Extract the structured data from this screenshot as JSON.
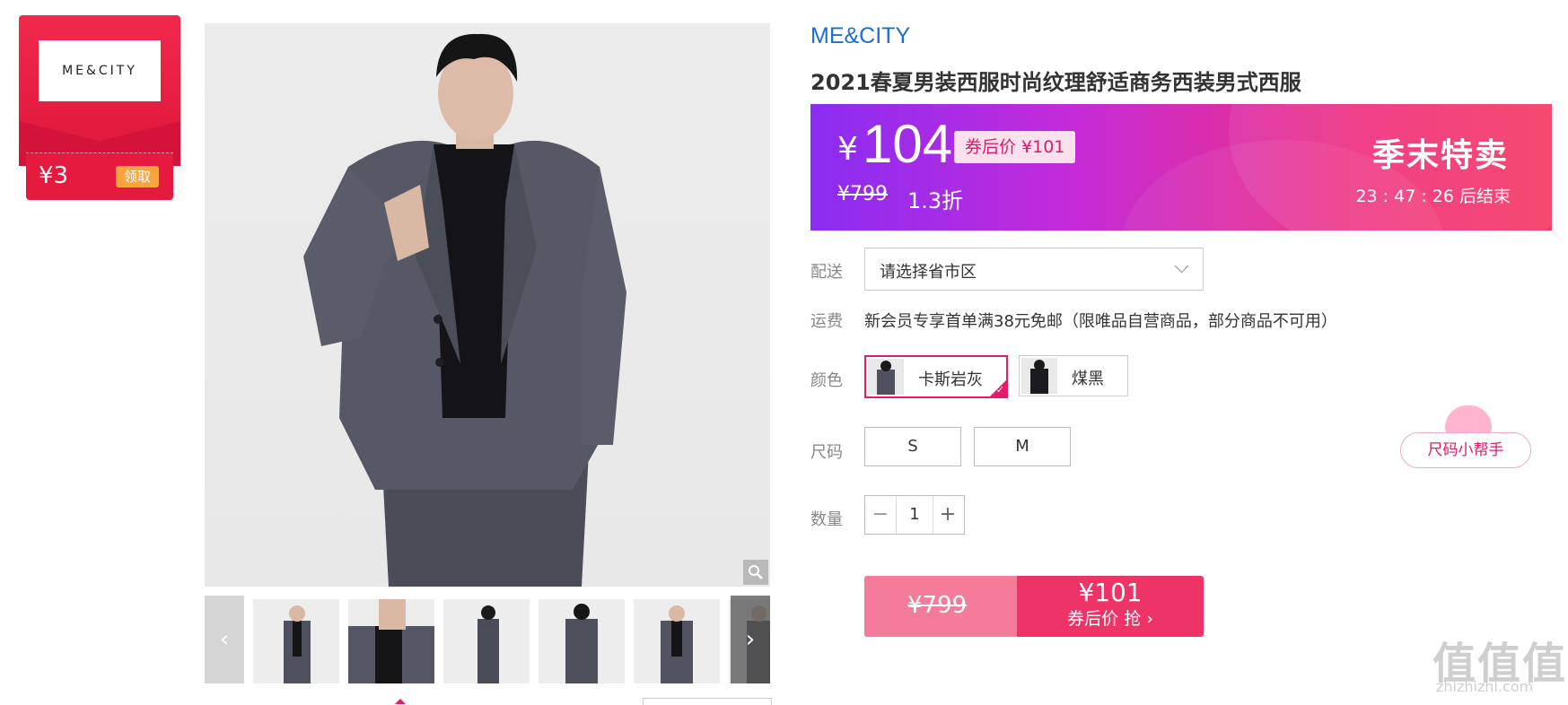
{
  "coupon": {
    "logo_text": "ME&CITY",
    "amount": "¥3",
    "claim_label": "领取"
  },
  "product": {
    "brand": "ME&CITY",
    "title": "2021春夏男装西服时尚纹理舒适商务西装男式西服"
  },
  "price_banner": {
    "currency": "¥",
    "price": "104",
    "after_coupon": "券后价 ¥101",
    "original_price": "¥799",
    "discount": "1.3折",
    "sale_label": "季末特卖",
    "countdown": "23 : 47 : 26  后结束"
  },
  "delivery": {
    "label": "配送",
    "placeholder": "请选择省市区"
  },
  "shipping": {
    "label": "运费",
    "text": "新会员专享首单满38元免邮（限唯品自营商品，部分商品不可用）"
  },
  "color": {
    "label": "颜色",
    "options": [
      {
        "name": "卡斯岩灰",
        "selected": true
      },
      {
        "name": "煤黑",
        "selected": false
      }
    ]
  },
  "size": {
    "label": "尺码",
    "options": [
      "S",
      "M"
    ],
    "helper_label": "尺码小帮手"
  },
  "quantity": {
    "label": "数量",
    "minus": "−",
    "value": "1",
    "plus": "+"
  },
  "buy": {
    "original_price": "¥799",
    "price": "¥101",
    "action_label": "券后价 抢 ›"
  },
  "gallery": {
    "thumb_count": 6,
    "prev_icon": "chevron-left-icon",
    "next_icon": "chevron-right-icon"
  },
  "watermark": {
    "text": "值值值",
    "url": "zhizhizhi.com"
  },
  "colors": {
    "accent": "#e21b6b",
    "brand_link": "#1a6fd1",
    "coupon_red": "#e6193f"
  }
}
